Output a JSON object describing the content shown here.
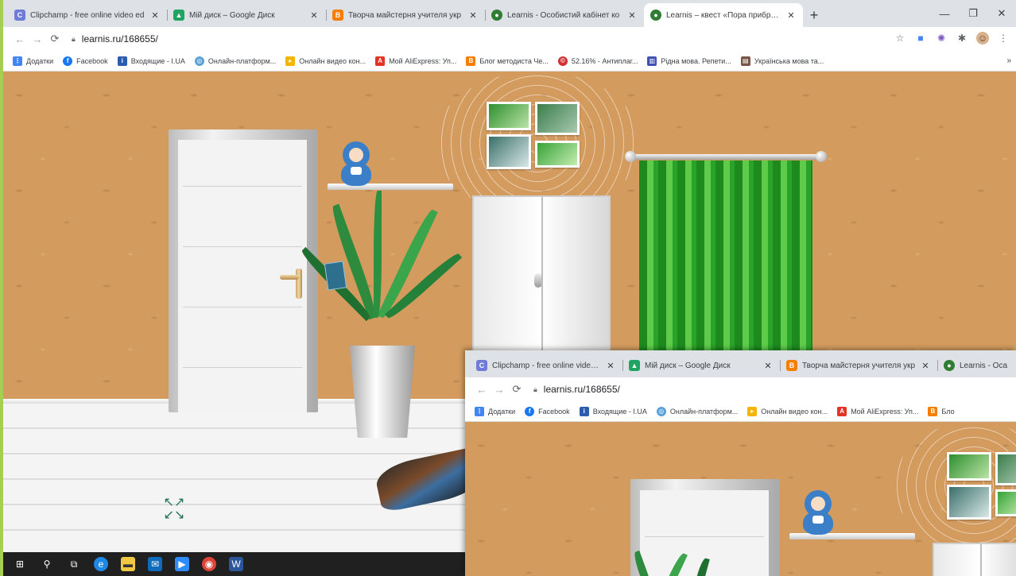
{
  "browser": {
    "tabs": [
      {
        "label": "Clipchamp - free online video ed",
        "icon": "clipchamp-icon",
        "color": "#6f7bd8",
        "active": false
      },
      {
        "label": "Мій диск – Google Диск",
        "icon": "google-drive-icon",
        "color": "#1fa463",
        "active": false
      },
      {
        "label": "Творча майстерня учителя укр",
        "icon": "blogger-icon",
        "color": "#f57d00",
        "active": false
      },
      {
        "label": "Learnis - Особистий кабінет ко",
        "icon": "learnis-icon",
        "color": "#2e7d32",
        "active": false
      },
      {
        "label": "Learnis – квест «Пора прибрати",
        "icon": "learnis-icon",
        "color": "#2e7d32",
        "active": true
      }
    ],
    "new_tab": "+",
    "url": "learnis.ru/168655/",
    "bookmarks": [
      {
        "label": "Додатки",
        "icon": "apps-icon",
        "color": "#4285f4"
      },
      {
        "label": "Facebook",
        "icon": "facebook-icon",
        "color": "#1877f2"
      },
      {
        "label": "Входящие - I.UA",
        "icon": "iua-icon",
        "color": "#2a5db0"
      },
      {
        "label": "Онлайн-платформ...",
        "icon": "platform-icon",
        "color": "#5aa0d8"
      },
      {
        "label": "Онлайн видео кон...",
        "icon": "video-icon",
        "color": "#f4b400"
      },
      {
        "label": "Мой AliExpress: Уп...",
        "icon": "aliexpress-icon",
        "color": "#e43225"
      },
      {
        "label": "Блог методиста Че...",
        "icon": "blogger-icon",
        "color": "#f57d00"
      },
      {
        "label": "52.16% - Антиплаг...",
        "icon": "antiplagiat-icon",
        "color": "#d32f2f"
      },
      {
        "label": "Рідна мова. Репети...",
        "icon": "ridna-mova-icon",
        "color": "#3f51b5"
      },
      {
        "label": "Українська мова та...",
        "icon": "ukr-mova-icon",
        "color": "#795548"
      }
    ]
  },
  "inset": {
    "tabs": [
      {
        "label": "Clipchamp - free online video ed",
        "icon": "clipchamp-icon",
        "color": "#6f7bd8"
      },
      {
        "label": "Мій диск – Google Диск",
        "icon": "google-drive-icon",
        "color": "#1fa463"
      },
      {
        "label": "Творча майстерня учителя укр",
        "icon": "blogger-icon",
        "color": "#f57d00"
      },
      {
        "label": "Learnis - Оса",
        "icon": "learnis-icon",
        "color": "#2e7d32"
      }
    ],
    "url": "learnis.ru/168655/",
    "bookmarks": [
      {
        "label": "Додатки",
        "icon": "apps-icon",
        "color": "#4285f4"
      },
      {
        "label": "Facebook",
        "icon": "facebook-icon",
        "color": "#1877f2"
      },
      {
        "label": "Входящие - I.UA",
        "icon": "iua-icon",
        "color": "#2a5db0"
      },
      {
        "label": "Онлайн-платформ...",
        "icon": "platform-icon",
        "color": "#5aa0d8"
      },
      {
        "label": "Онлайн видео кон...",
        "icon": "video-icon",
        "color": "#f4b400"
      },
      {
        "label": "Мой AliExpress: Уп...",
        "icon": "aliexpress-icon",
        "color": "#e43225"
      },
      {
        "label": "Бло",
        "icon": "blogger-icon",
        "color": "#f57d00"
      }
    ]
  },
  "taskbar": {
    "icons": [
      "windows-start-icon",
      "search-icon",
      "task-view-icon",
      "edge-icon",
      "file-explorer-icon",
      "mail-icon",
      "zoom-icon",
      "chrome-icon",
      "word-icon"
    ]
  },
  "colors": {
    "wall": "#d39b5e",
    "accent_green": "#a4cf52",
    "curtain": "#2aa32a"
  }
}
